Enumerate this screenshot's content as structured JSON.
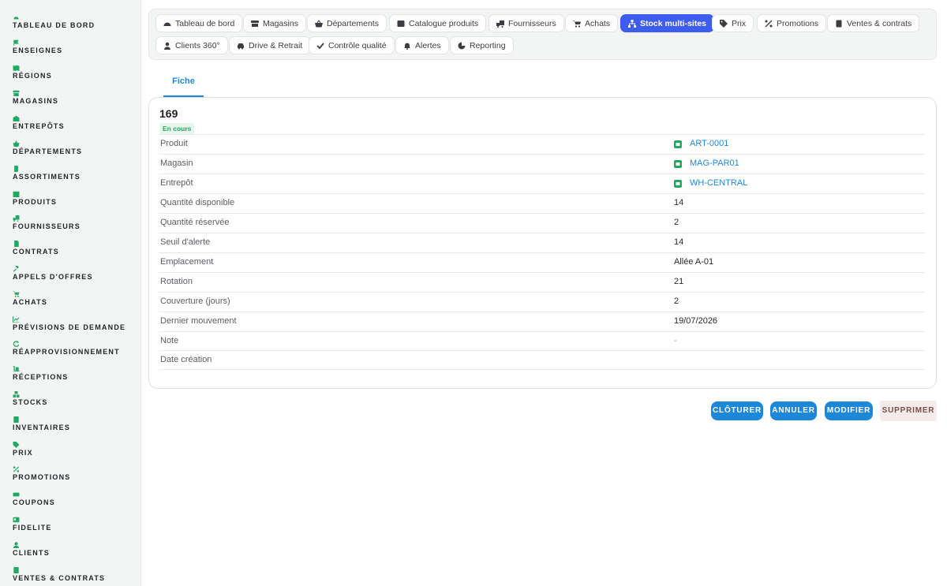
{
  "colors": {
    "accent": "#1faa62",
    "primary": "#1e88d8",
    "active_tab": "#3f5cf0",
    "danger_bg": "#f3ecea"
  },
  "sidebar": {
    "items": [
      {
        "label": "Tableau de bord",
        "icon": "dashboard-icon"
      },
      {
        "label": "Enseignes",
        "icon": "flag-icon"
      },
      {
        "label": "Régions",
        "icon": "map-icon"
      },
      {
        "label": "Magasins",
        "icon": "store-icon"
      },
      {
        "label": "Entrepôts",
        "icon": "warehouse-icon"
      },
      {
        "label": "Départements",
        "icon": "basket-icon"
      },
      {
        "label": "Assortiments",
        "icon": "clipboard-icon"
      },
      {
        "label": "Produits",
        "icon": "box-icon"
      },
      {
        "label": "Fournisseurs",
        "icon": "truck-icon"
      },
      {
        "label": "Contrats",
        "icon": "document-icon"
      },
      {
        "label": "Appels d'offres",
        "icon": "gavel-icon"
      },
      {
        "label": "Achats",
        "icon": "cart-icon"
      },
      {
        "label": "Prévisions de demande",
        "icon": "chart-line-icon"
      },
      {
        "label": "Réapprovisionnement",
        "icon": "refresh-icon"
      },
      {
        "label": "Réceptions",
        "icon": "dolly-icon"
      },
      {
        "label": "Stocks",
        "icon": "boxes-icon"
      },
      {
        "label": "Inventaires",
        "icon": "checklist-icon"
      },
      {
        "label": "Prix",
        "icon": "tags-icon"
      },
      {
        "label": "Promotions",
        "icon": "percent-icon"
      },
      {
        "label": "Coupons",
        "icon": "ticket-icon"
      },
      {
        "label": "Fidelite",
        "icon": "card-icon"
      },
      {
        "label": "Clients",
        "icon": "user-icon"
      },
      {
        "label": "Ventes & contrats",
        "icon": "receipt-icon"
      }
    ]
  },
  "topnav": {
    "tabs": [
      {
        "label": "Tableau de bord",
        "icon": "dashboard-icon"
      },
      {
        "label": "Magasins",
        "icon": "store-icon"
      },
      {
        "label": "Départements",
        "icon": "basket-icon"
      },
      {
        "label": "Catalogue produits",
        "icon": "box-icon"
      },
      {
        "label": "Fournisseurs",
        "icon": "truck-icon"
      },
      {
        "label": "Achats",
        "icon": "cart-icon"
      },
      {
        "label": "Stock multi-sites",
        "icon": "sitemap-icon",
        "active": true
      },
      {
        "label": "Prix",
        "icon": "tags-icon"
      },
      {
        "label": "Promotions",
        "icon": "percent-icon"
      },
      {
        "label": "Ventes & contrats",
        "icon": "receipt-icon"
      },
      {
        "label": "Clients 360°",
        "icon": "user-icon"
      },
      {
        "label": "Drive & Retrait",
        "icon": "car-icon"
      },
      {
        "label": "Contrôle qualité",
        "icon": "check-icon"
      },
      {
        "label": "Alertes",
        "icon": "bell-icon"
      },
      {
        "label": "Reporting",
        "icon": "pie-icon"
      }
    ]
  },
  "subtabs": {
    "active": "Fiche"
  },
  "record": {
    "id": "169",
    "status": "En cours",
    "fields": [
      {
        "label": "Produit",
        "value": "ART-0001",
        "link": true
      },
      {
        "label": "Magasin",
        "value": "MAG-PAR01",
        "link": true
      },
      {
        "label": "Entrepôt",
        "value": "WH-CENTRAL",
        "link": true
      },
      {
        "label": "Quantité disponible",
        "value": "14"
      },
      {
        "label": "Quantité réservée",
        "value": "2"
      },
      {
        "label": "Seuil d'alerte",
        "value": "14"
      },
      {
        "label": "Emplacement",
        "value": "Allée A-01"
      },
      {
        "label": "Rotation",
        "value": "21"
      },
      {
        "label": "Couverture (jours)",
        "value": "2"
      },
      {
        "label": "Dernier mouvement",
        "value": "19/07/2026"
      },
      {
        "label": "Note",
        "value": "-",
        "muted": true
      },
      {
        "label": "Date création",
        "value": ""
      }
    ]
  },
  "actions": {
    "close_label": "Clôturer",
    "cancel_label": "Annuler",
    "edit_label": "Modifier",
    "delete_label": "Supprimer"
  }
}
